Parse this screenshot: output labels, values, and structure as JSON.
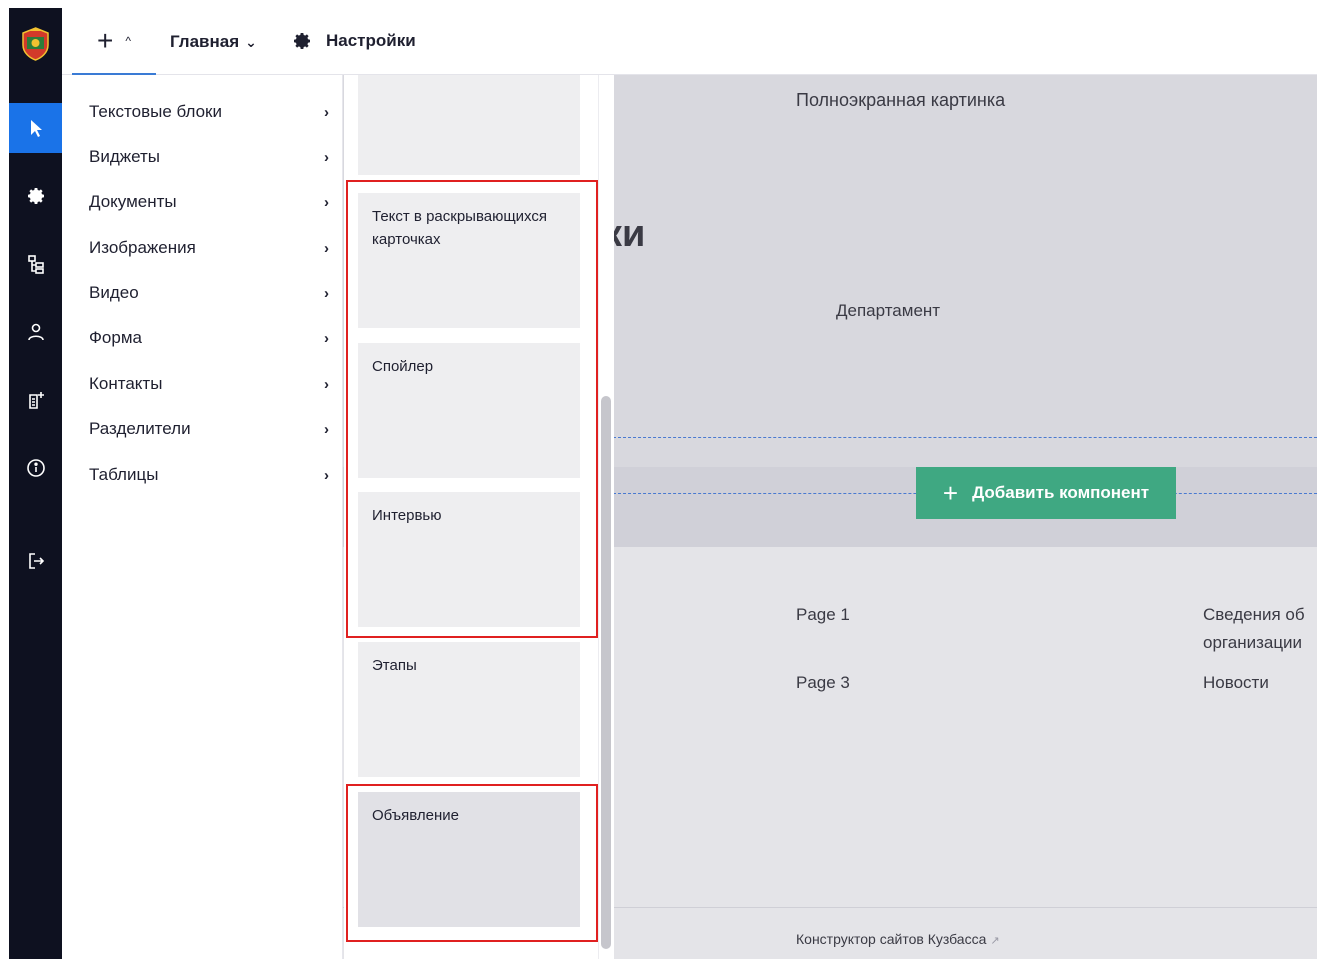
{
  "topbar": {
    "add_icon": "plus-icon",
    "add_caret": "^",
    "home_label": "Главная",
    "home_caret": "⌄",
    "settings_label": "Настройки"
  },
  "rail": {
    "items": [
      {
        "icon": "pointer-icon",
        "active": true
      },
      {
        "icon": "gear-icon"
      },
      {
        "icon": "sitemap-icon"
      },
      {
        "icon": "user-icon"
      },
      {
        "icon": "add-page-icon"
      },
      {
        "icon": "info-icon"
      },
      {
        "icon": "logout-icon"
      }
    ]
  },
  "menu": {
    "items": [
      {
        "label": "Текстовые блоки",
        "chevron": "›"
      },
      {
        "label": "Виджеты",
        "chevron": "›"
      },
      {
        "label": "Документы",
        "chevron": "›"
      },
      {
        "label": "Изображения",
        "chevron": "›"
      },
      {
        "label": "Видео",
        "chevron": "›"
      },
      {
        "label": "Форма",
        "chevron": "›"
      },
      {
        "label": "Контакты",
        "chevron": "›"
      },
      {
        "label": "Разделители",
        "chevron": "›"
      },
      {
        "label": "Таблицы",
        "chevron": "›"
      }
    ]
  },
  "components": [
    {
      "label": ""
    },
    {
      "label": "Текст в раскрывающихся карточках"
    },
    {
      "label": "Спойлер"
    },
    {
      "label": "Интервью"
    },
    {
      "label": "Этапы"
    },
    {
      "label": "Объявление"
    }
  ],
  "canvas": {
    "fullscreen_label": "Полноэкранная картинка",
    "heading_fragment": "ки",
    "department": "Департамент",
    "add_component_label": "Добавить компонент",
    "links": {
      "page1": "Page 1",
      "page3": "Page 3",
      "info_line1": "Сведения об",
      "info_line2": "организации",
      "news": "Новости"
    },
    "footer": "Конструктор сайтов Кузбасса",
    "footer_ext": "↗"
  },
  "colors": {
    "rail_bg": "#0e1120",
    "rail_active": "#1a73e8",
    "add_component_bg": "#3fa882",
    "highlight": "#e02020"
  }
}
